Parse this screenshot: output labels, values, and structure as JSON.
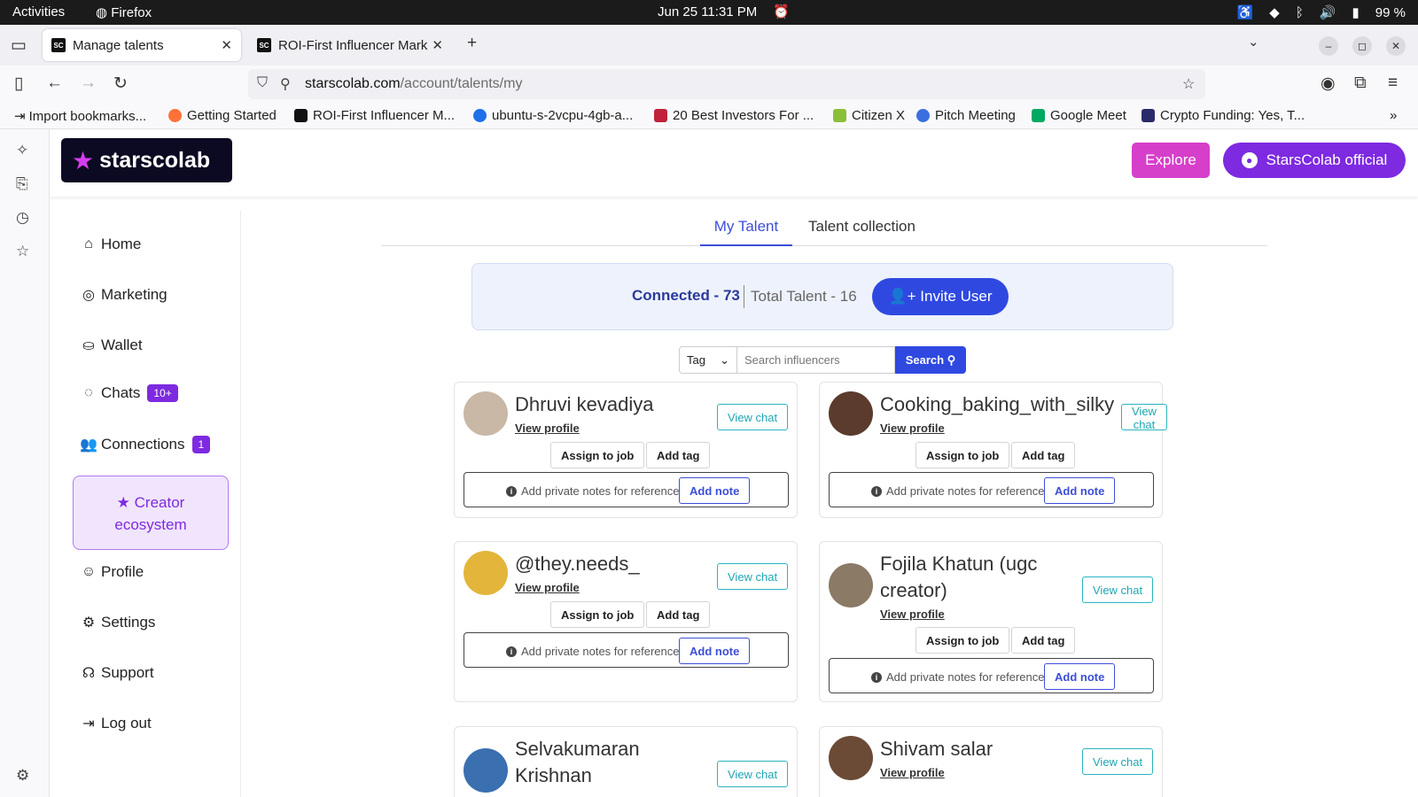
{
  "os": {
    "activities": "Activities",
    "app": "Firefox",
    "clock": "Jun 25  11:31 PM",
    "battery": "99 %"
  },
  "browser": {
    "tabs": [
      {
        "label": "Manage talents"
      },
      {
        "label": "ROI-First Influencer Mark"
      }
    ],
    "url_domain": "starscolab.com",
    "url_path": "/account/talents/my",
    "bookmarks": [
      "Import bookmarks...",
      "Getting Started",
      "ROI-First Influencer M...",
      "ubuntu-s-2vcpu-4gb-a...",
      "20 Best Investors For ...",
      "Citizen X",
      "Pitch Meeting",
      "Google Meet",
      "Crypto Funding: Yes, T..."
    ]
  },
  "header": {
    "logo": "starscolab",
    "explore": "Explore",
    "official": "StarsColab official"
  },
  "sidebar": {
    "home": "Home",
    "marketing": "Marketing",
    "wallet": "Wallet",
    "chats": "Chats",
    "chats_badge": "10+",
    "connections": "Connections",
    "connections_badge": "1",
    "creator_line1": "Creator",
    "creator_line2": "ecosystem",
    "profile": "Profile",
    "settings": "Settings",
    "support": "Support",
    "logout": "Log out"
  },
  "main": {
    "tab_my_talent": "My Talent",
    "tab_collection": "Talent collection",
    "connected": "Connected - 73",
    "total": "Total Talent - 16",
    "invite": "Invite User",
    "tag": "Tag",
    "search_placeholder": "Search influencers",
    "search_btn": "Search"
  },
  "card_labels": {
    "view_chat": "View chat",
    "view_profile": "View profile",
    "assign": "Assign to job",
    "add_tag": "Add tag",
    "notes_text": "Add private notes for reference",
    "add_note": "Add note"
  },
  "talents": [
    {
      "name": "Dhruvi kevadiya"
    },
    {
      "name": "Cooking_baking_with_silky"
    },
    {
      "name": "@they.needs_"
    },
    {
      "name_line1": "Fojila Khatun (ugc",
      "name_line2": "creator)"
    },
    {
      "name_line1": "Selvakumaran",
      "name_line2": "Krishnan"
    },
    {
      "name": "Shivam salar"
    }
  ],
  "colors": {
    "brand_purple": "#7d2ae0",
    "explore_pink": "#d63fc9",
    "primary_blue": "#2f49e0",
    "teal": "#1fa6b3"
  }
}
